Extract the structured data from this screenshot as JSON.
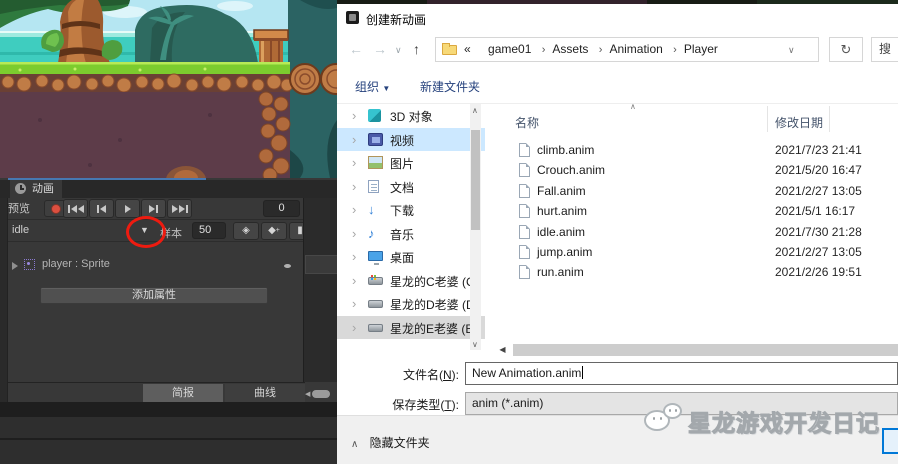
{
  "unity": {
    "animation_tab": "动画",
    "preview": "预览",
    "frame_value": "0",
    "clip_name": "idle",
    "samples_label": "样本",
    "samples_value": "50",
    "property_label": "player : Sprite",
    "add_property": "添加属性",
    "dopesheet_tab": "简报",
    "curves_tab": "曲线"
  },
  "dialog": {
    "title": "创建新动画",
    "address": {
      "guillemet": "«",
      "separator": "›",
      "crumbs": [
        "game01",
        "Assets",
        "Animation",
        "Player"
      ]
    },
    "search_hint": "搜",
    "toolbar": {
      "organize": "组织",
      "organize_caret": "▼",
      "new_folder": "新建文件夹"
    },
    "tree_items": [
      {
        "label": "3D 对象"
      },
      {
        "label": "视频"
      },
      {
        "label": "图片"
      },
      {
        "label": "文档"
      },
      {
        "label": "下载"
      },
      {
        "label": "音乐"
      },
      {
        "label": "桌面"
      },
      {
        "label": "星龙的C老婆 (C:"
      },
      {
        "label": "星龙的D老婆 (D"
      },
      {
        "label": "星龙的E老婆 (E:"
      }
    ],
    "columns": {
      "name": "名称",
      "date": "修改日期"
    },
    "files": [
      {
        "name": "climb.anim",
        "date": "2021/7/23 21:41"
      },
      {
        "name": "Crouch.anim",
        "date": "2021/5/20 16:47"
      },
      {
        "name": "Fall.anim",
        "date": "2021/2/27 13:05"
      },
      {
        "name": "hurt.anim",
        "date": "2021/5/1 16:17"
      },
      {
        "name": "idle.anim",
        "date": "2021/7/30 21:28"
      },
      {
        "name": "jump.anim",
        "date": "2021/2/27 13:05"
      },
      {
        "name": "run.anim",
        "date": "2021/2/26 19:51"
      }
    ],
    "filename": {
      "label_pre": "文件名(",
      "label_key": "N",
      "label_post": "):",
      "value": "New Animation.anim"
    },
    "filetype": {
      "label_pre": "保存类型(",
      "label_key": "T",
      "label_post": "):",
      "value": "anim (*.anim)"
    },
    "hide_folders": "隐藏文件夹"
  },
  "watermark": {
    "text": "星龙游戏开发日记"
  },
  "glyphs": {
    "back": "←",
    "forward": "→",
    "up": "↑",
    "chevron_down": "∨",
    "chevron_up": "∧",
    "chevron_right": "›",
    "refresh": "↻",
    "dropdown": "▼",
    "sort_caret": "∧",
    "keyframe_view": "◈",
    "add_keyframe": "◆",
    "add_event": "▮",
    "plus": "+",
    "scroll_left": "◀",
    "music_note": "♪",
    "download_arrow": "↓"
  },
  "colors": {
    "accent_blue": "#0078d7",
    "selection_blue": "#cce8ff",
    "selection_gray": "#d9d9d9",
    "record_red": "#dc4f3f",
    "annotation_red": "#ee1b10",
    "unity_bg": "#383838",
    "focus_line": "#4678b2"
  }
}
